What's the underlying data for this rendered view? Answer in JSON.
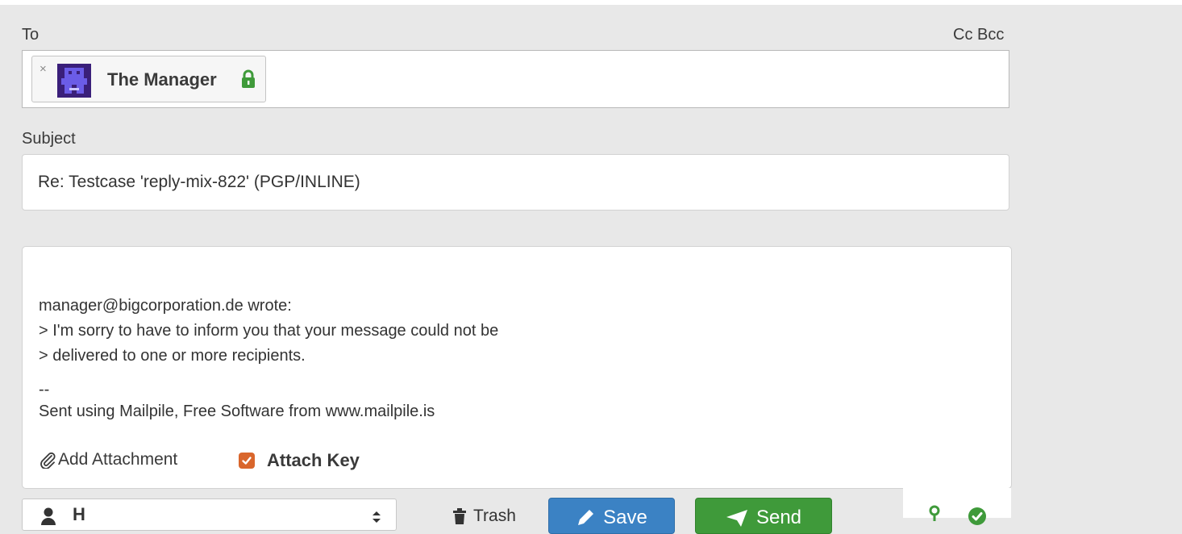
{
  "compose": {
    "to_label": "To",
    "cc_label": "Cc",
    "bcc_label": "Bcc",
    "recipient": {
      "remove_symbol": "×",
      "name": "The Manager",
      "avatar_icon": "robot-avatar-icon",
      "lock_icon": "lock-icon",
      "lock_color": "#3f9a3a"
    },
    "subject_label": "Subject",
    "subject_value": "Re: Testcase 'reply-mix-822' (PGP/INLINE)",
    "body": {
      "lines": [
        "manager@bigcorporation.de wrote:",
        "> I'm sorry to have to inform you that your message could not be",
        "> delivered to one or more recipients.",
        "",
        "--",
        "Sent using Mailpile, Free Software from www.mailpile.is"
      ]
    },
    "add_attachment_label": "Add Attachment",
    "attach_key_label": "Attach Key",
    "attach_key_checked": true,
    "checkbox_color": "#d9662c"
  },
  "footer": {
    "from_value": "H",
    "trash_label": "Trash",
    "save_label": "Save",
    "send_label": "Send",
    "save_color": "#3b82c4",
    "send_color": "#3f9a3a"
  }
}
